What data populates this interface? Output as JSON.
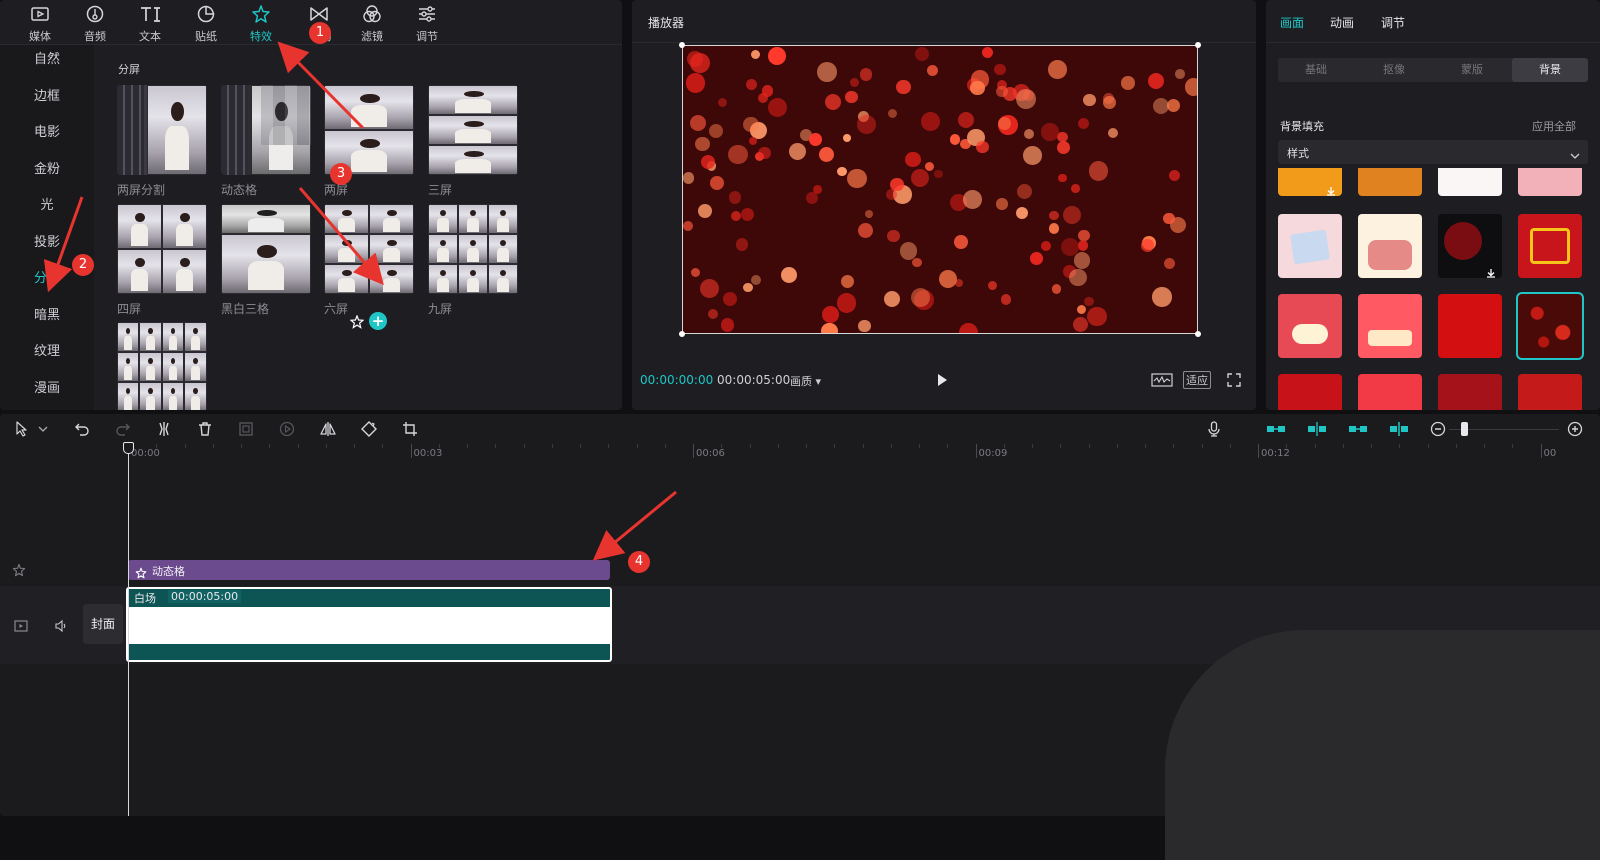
{
  "toolbar": {
    "items": [
      {
        "label": "媒体",
        "icon": "media-icon"
      },
      {
        "label": "音频",
        "icon": "audio-icon"
      },
      {
        "label": "文本",
        "icon": "text-icon"
      },
      {
        "label": "贴纸",
        "icon": "sticker-icon"
      },
      {
        "label": "特效",
        "icon": "effects-icon",
        "active": true
      },
      {
        "label": "场",
        "icon": "transition-icon"
      },
      {
        "label": "滤镜",
        "icon": "filter-icon"
      },
      {
        "label": "调节",
        "icon": "adjust-icon"
      }
    ]
  },
  "categories": [
    "自然",
    "边框",
    "电影",
    "金粉",
    "光",
    "投影",
    "分屏",
    "暗黑",
    "纹理",
    "漫画"
  ],
  "active_category": "分屏",
  "effects": {
    "section_title": "分屏",
    "items": [
      "两屏分割",
      "动态格",
      "两屏",
      "三屏",
      "四屏",
      "黑白三格",
      "六屏",
      "九屏",
      ""
    ]
  },
  "player": {
    "title": "播放器",
    "time_current": "00:00:00:00",
    "time_total": "00:00:05:00",
    "quality": "画质",
    "fit": "适应"
  },
  "properties": {
    "tabs": [
      "画面",
      "动画",
      "调节"
    ],
    "segments": [
      "基础",
      "抠像",
      "蒙版",
      "背景"
    ],
    "active_segment": "背景",
    "bg_fill_label": "背景填充",
    "apply_all": "应用全部",
    "style_select": "样式"
  },
  "timeline": {
    "ticks": [
      "00:00",
      "00:03",
      "00:06",
      "00:09",
      "00:12",
      "00"
    ],
    "effect_clip_label": "动态格",
    "video_clip_title": "白场",
    "video_clip_duration": "00:00:05:00",
    "cover_label": "封面"
  },
  "annotations": [
    "1",
    "2",
    "3",
    "4"
  ],
  "colors": {
    "accent": "#20c6c6",
    "effect_clip": "#6b4a8e",
    "video_clip": "#0d5454",
    "badge": "#e8342f"
  }
}
